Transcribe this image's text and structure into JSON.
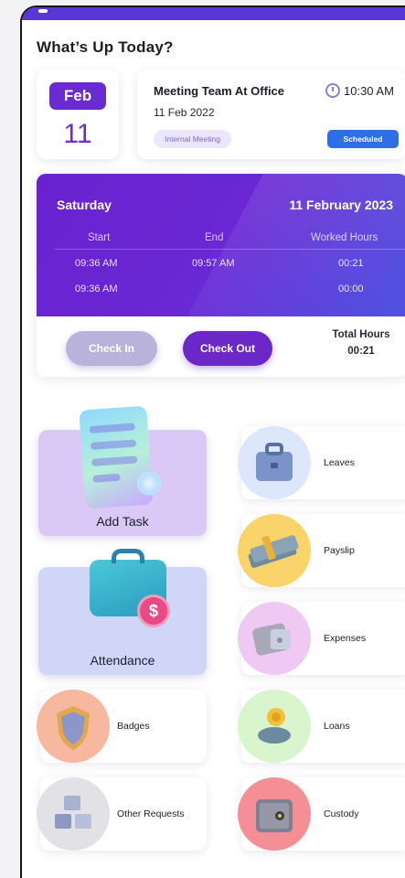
{
  "header": {
    "title": "What’s Up Today?"
  },
  "date_card": {
    "month": "Feb",
    "day": "11"
  },
  "meeting": {
    "title": "Meeting Team At Office",
    "time": "10:30 AM",
    "date": "11 Feb 2022",
    "tag": "Internal Meeting",
    "status": "Scheduled"
  },
  "attendance": {
    "day": "Saturday",
    "date": "11 February 2023",
    "columns": [
      "Start",
      "End",
      "Worked Hours"
    ],
    "rows": [
      {
        "start": "09:36 AM",
        "end": "09:57 AM",
        "worked": "00:21"
      },
      {
        "start": "09:36 AM",
        "end": "",
        "worked": "00:00"
      }
    ],
    "check_in_label": "Check In",
    "check_out_label": "Check Out",
    "total_label": "Total Hours",
    "total_value": "00:21"
  },
  "tiles": {
    "add_task": "Add Task",
    "attendance": "Attendance",
    "leaves": "Leaves",
    "payslip": "Payslip",
    "expenses": "Expenses",
    "badges": "Badges",
    "loans": "Loans",
    "other_requests": "Other Requests",
    "custody": "Custody"
  },
  "colors": {
    "accent": "#6a2bd0",
    "status_blue": "#2e6fe8",
    "leaves_circle": "#dde7fb",
    "payslip_circle": "#fbd36b",
    "expenses_circle": "#efc8f4",
    "badges_circle": "#f8b79f",
    "loans_circle": "#d8f5cd",
    "other_circle": "#e1e1e6",
    "custody_circle": "#f38f95"
  },
  "icons": {
    "leaves": "briefcase-icon",
    "payslip": "money-stack-icon",
    "expenses": "wallet-icon",
    "badges": "shield-icon",
    "loans": "coin-hand-icon",
    "other_requests": "boxes-icon",
    "custody": "safe-icon",
    "meeting_time": "clock-icon"
  }
}
